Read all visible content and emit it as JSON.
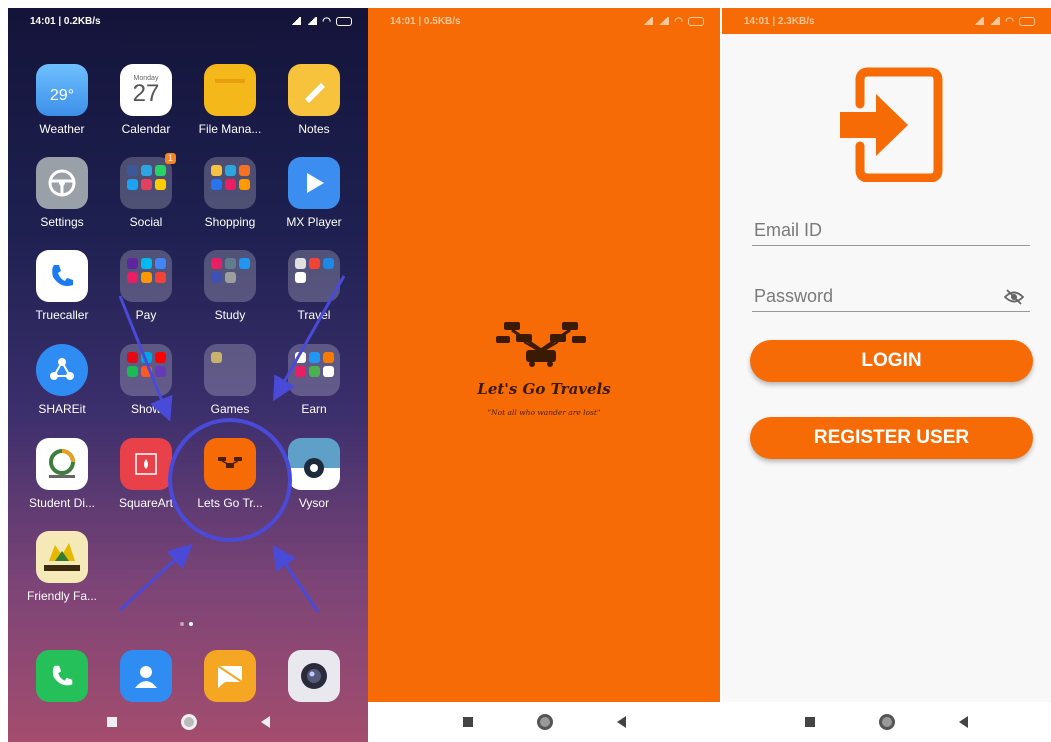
{
  "home": {
    "status": {
      "time_speed": "14:01 | 0.2KB/s"
    },
    "apps": [
      {
        "name": "weather-app",
        "label": "Weather",
        "icon_text": "29°",
        "color": "#4aa3f0"
      },
      {
        "name": "calendar-app",
        "label": "Calendar",
        "icon_small": "Monday",
        "icon_text": "27",
        "color": "#ffffff"
      },
      {
        "name": "file-manager-app",
        "label": "File Mana...",
        "color": "#f4b81a"
      },
      {
        "name": "notes-app",
        "label": "Notes",
        "color": "#f7c23c"
      },
      {
        "name": "settings-app",
        "label": "Settings",
        "color": "#9aa0a8"
      },
      {
        "name": "social-folder",
        "label": "Social",
        "badge": "1"
      },
      {
        "name": "shopping-folder",
        "label": "Shopping"
      },
      {
        "name": "mx-player-app",
        "label": "MX Player",
        "color": "#3b8ef0"
      },
      {
        "name": "truecaller-app",
        "label": "Truecaller",
        "color": "#ffffff"
      },
      {
        "name": "pay-folder",
        "label": "Pay"
      },
      {
        "name": "study-folder",
        "label": "Study"
      },
      {
        "name": "travel-folder",
        "label": "Travel"
      },
      {
        "name": "shareit-app",
        "label": "SHAREit",
        "color": "#2f8cf3"
      },
      {
        "name": "show-folder",
        "label": "Show"
      },
      {
        "name": "games-folder",
        "label": "Games"
      },
      {
        "name": "earn-folder",
        "label": "Earn"
      },
      {
        "name": "student-diary-app",
        "label": "Student Di...",
        "color": "#ffffff"
      },
      {
        "name": "squareart-app",
        "label": "SquareArt",
        "color": "#e8414a"
      },
      {
        "name": "lets-go-travels-app",
        "label": "Lets Go Tr...",
        "color": "#f66b05"
      },
      {
        "name": "vysor-app",
        "label": "Vysor",
        "color": "#5fa0c8"
      },
      {
        "name": "friendly-farm-app",
        "label": "Friendly Fa...",
        "color": "#f5e9b8"
      }
    ],
    "dock": [
      {
        "name": "phone-app",
        "color": "#25c05a"
      },
      {
        "name": "contacts-app",
        "color": "#2f8cf3"
      },
      {
        "name": "messages-app",
        "color": "#f5a623"
      },
      {
        "name": "camera-app",
        "color": "#e8e8ee"
      }
    ]
  },
  "splash": {
    "status": {
      "time_speed": "14:01 | 0.5KB/s"
    },
    "title": "Let's Go Travels",
    "tagline": "\"Not all who wander are lost\""
  },
  "login": {
    "status": {
      "time_speed": "14:01 | 2.3KB/s"
    },
    "email_placeholder": "Email ID",
    "password_placeholder": "Password",
    "login_button": "LOGIN",
    "register_button": "REGISTER USER"
  },
  "colors": {
    "accent": "#f66b05",
    "annotation": "#4a4ad8"
  }
}
